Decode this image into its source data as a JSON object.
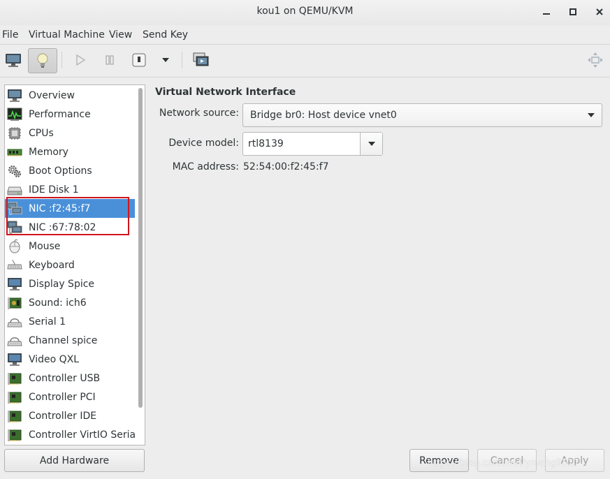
{
  "window": {
    "title": "kou1 on QEMU/KVM"
  },
  "menu": [
    "File",
    "Virtual Machine",
    "View",
    "Send Key"
  ],
  "sidebar": {
    "items": [
      {
        "label": "Overview",
        "icon": "monitor-icon"
      },
      {
        "label": "Performance",
        "icon": "performance-graph-icon"
      },
      {
        "label": "CPUs",
        "icon": "cpu-chip-icon"
      },
      {
        "label": "Memory",
        "icon": "memory-module-icon"
      },
      {
        "label": "Boot Options",
        "icon": "gears-icon"
      },
      {
        "label": "IDE Disk 1",
        "icon": "hard-disk-icon"
      },
      {
        "label": "NIC :f2:45:f7",
        "icon": "network-card-icon"
      },
      {
        "label": "NIC :67:78:02",
        "icon": "network-card-icon"
      },
      {
        "label": "Mouse",
        "icon": "mouse-icon"
      },
      {
        "label": "Keyboard",
        "icon": "keyboard-icon"
      },
      {
        "label": "Display Spice",
        "icon": "display-icon"
      },
      {
        "label": "Sound: ich6",
        "icon": "sound-card-icon"
      },
      {
        "label": "Serial 1",
        "icon": "serial-port-icon"
      },
      {
        "label": "Channel spice",
        "icon": "channel-icon"
      },
      {
        "label": "Video QXL",
        "icon": "video-monitor-icon"
      },
      {
        "label": "Controller USB",
        "icon": "controller-card-icon"
      },
      {
        "label": "Controller PCI",
        "icon": "controller-card-icon"
      },
      {
        "label": "Controller IDE",
        "icon": "controller-card-icon"
      },
      {
        "label": "Controller VirtIO Serial",
        "icon": "controller-card-icon"
      }
    ],
    "selected_index": 6,
    "add_hardware_label": "Add Hardware"
  },
  "details": {
    "heading": "Virtual Network Interface",
    "network_source_label": "Network source:",
    "network_source_value": "Bridge br0: Host device vnet0",
    "device_model_label": "Device model:",
    "device_model_value": "rtl8139",
    "mac_label": "MAC address:",
    "mac_value": "52:54:00:f2:45:f7"
  },
  "buttons": {
    "remove": "Remove",
    "cancel": "Cancel",
    "apply": "Apply"
  },
  "watermark": "https://blog.csdn.net/ymeng9527",
  "colors": {
    "selection": "#4a90d9",
    "highlight_box": "#d0141c"
  }
}
